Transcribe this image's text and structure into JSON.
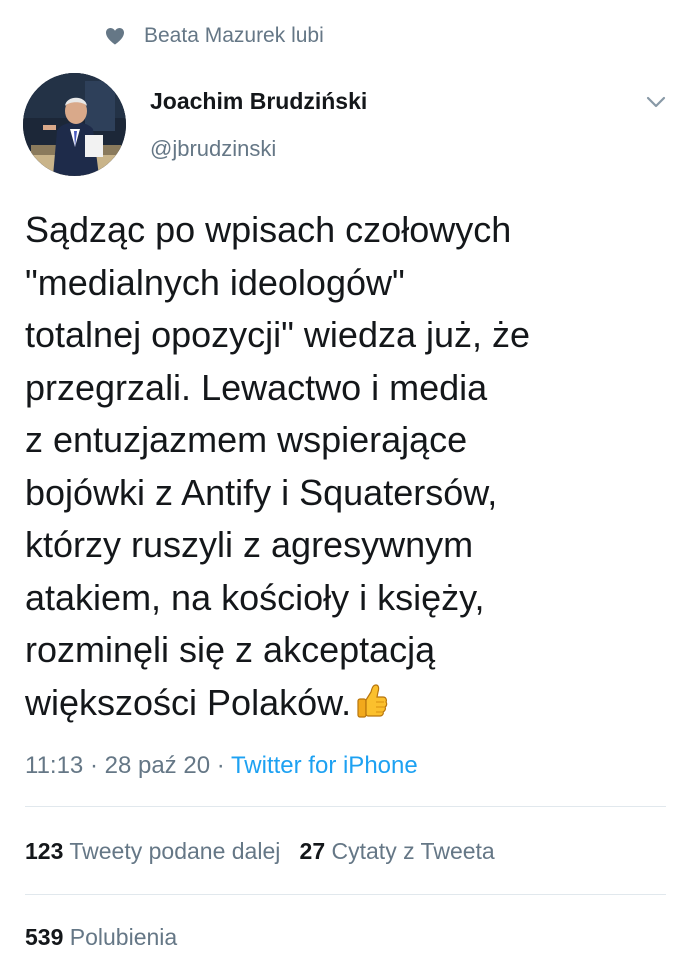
{
  "social_context": {
    "text": "Beata Mazurek lubi",
    "icon": "heart-icon"
  },
  "author": {
    "name": "Joachim Brudziński",
    "handle": "@jbrudzinski"
  },
  "tweet": {
    "text": "Sądząc po wpisach czołowych\n\"medialnych ideologów\"\ntotalnej opozycji\" wiedza już, że\nprzegrzali. Lewactwo i media\nz entuzjazmem wspierające\nbojówki z Antify i Squatersów,\nktórzy ruszyli z agresywnym\natakiem, na kościoły i księży,\nrozminęli się z akceptacją\nwiększości Polaków.",
    "emoji": "thumbs-up-icon",
    "time": "11:13",
    "separator": "·",
    "date": "28 paź 20",
    "source": "Twitter for iPhone"
  },
  "stats": {
    "retweets_count": "123",
    "retweets_label": "Tweety podane dalej",
    "quotes_count": "27",
    "quotes_label": "Cytaty z Tweeta",
    "likes_count": "539",
    "likes_label": "Polubienia"
  },
  "colors": {
    "text": "#14171a",
    "secondary": "#657786",
    "link": "#1da1f2",
    "divider": "#e1e8ed"
  }
}
